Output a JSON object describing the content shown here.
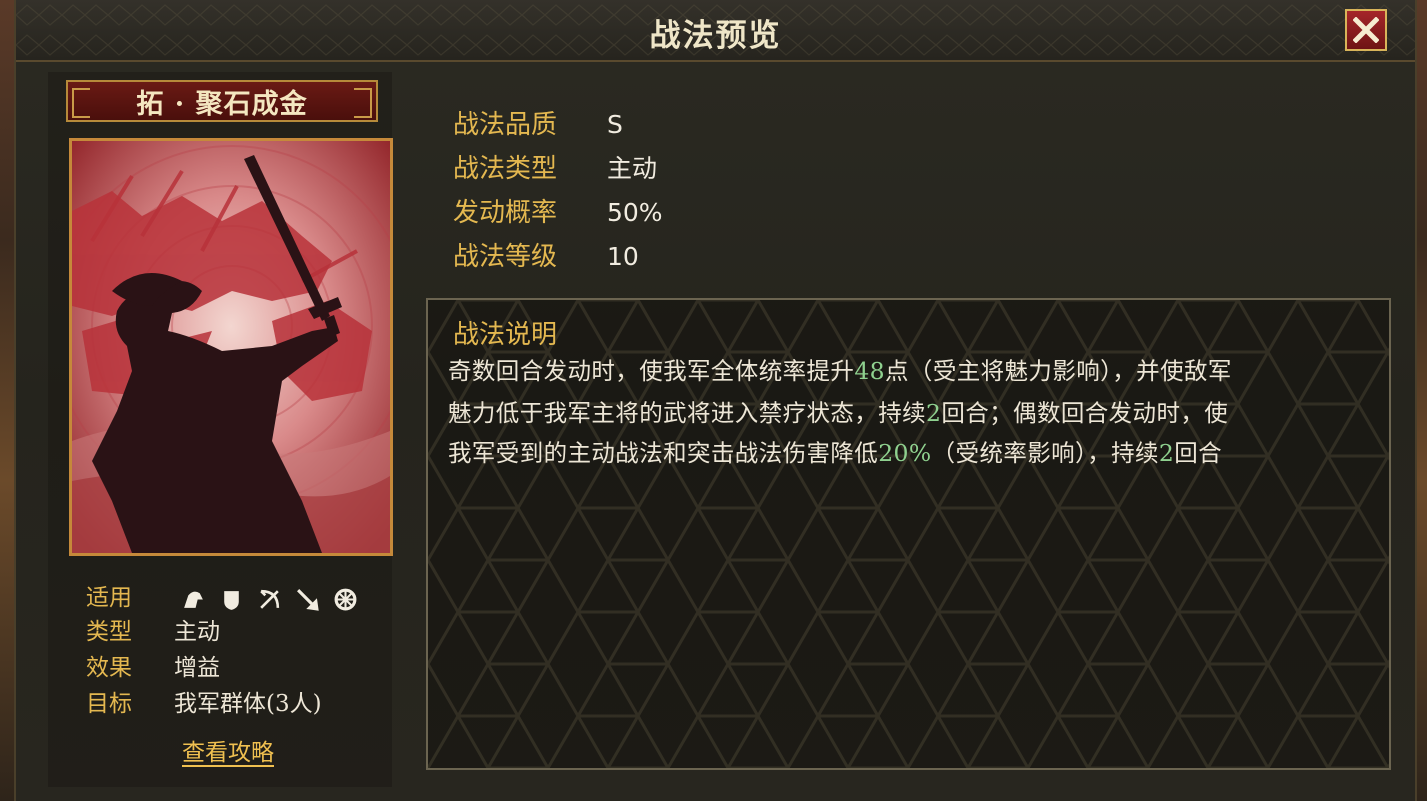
{
  "window": {
    "title": "战法预览",
    "close_label": "✕"
  },
  "skill": {
    "name": "拓 · 聚石成金",
    "info": [
      {
        "key": "适用",
        "icons": [
          "cavalry-icon",
          "shield-icon",
          "archer-icon",
          "spear-icon",
          "siege-icon"
        ]
      },
      {
        "key": "类型",
        "value": "主动"
      },
      {
        "key": "效果",
        "value": "增益"
      },
      {
        "key": "目标",
        "value": "我军群体(3人)"
      }
    ],
    "guide_link": "查看攻略",
    "stats": [
      {
        "key": "战法品质",
        "value": "S"
      },
      {
        "key": "战法类型",
        "value": "主动"
      },
      {
        "key": "发动概率",
        "value": "50%"
      },
      {
        "key": "战法等级",
        "value": "10"
      }
    ],
    "description_title": "战法说明",
    "description_lines": [
      [
        {
          "text": "奇数回合发动时，使我军全体统率提升"
        },
        {
          "text": "48",
          "hl": true
        },
        {
          "text": "点（受主将魅力影响），并使敌军"
        }
      ],
      [
        {
          "text": "魅力低于我军主将的武将进入禁疗状态，持续"
        },
        {
          "text": "2",
          "hl": true
        },
        {
          "text": "回合；偶数回合发动时，使"
        }
      ],
      [
        {
          "text": "我军受到的主动战法和突击战法伤害降低"
        },
        {
          "text": "20%",
          "hl": true
        },
        {
          "text": "（受统率影响），持续"
        },
        {
          "text": "2",
          "hl": true
        },
        {
          "text": "回合"
        }
      ]
    ]
  },
  "colors": {
    "label_gold": "#e4b850",
    "text_light": "#ede6d6",
    "highlight_green": "#8fd18f",
    "close_red": "#a5262a",
    "card_red": "#7a1a1e"
  }
}
